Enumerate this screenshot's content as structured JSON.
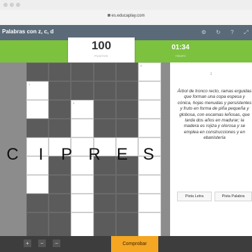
{
  "browser": {
    "url": "es.educaplay.com"
  },
  "game": {
    "title": "Palabras con z, c, d",
    "score": "100",
    "score_label": "PUNTOS",
    "timer": "01:34",
    "timer_label": "TIEMPO"
  },
  "toolbar_icons": [
    "settings-icon",
    "restart-icon",
    "help-icon",
    "fullscreen-icon"
  ],
  "board": {
    "answer_letters": [
      "C",
      "I",
      "P",
      "R",
      "E",
      "S"
    ],
    "cell_numbers": {
      "n1": "1",
      "n2": "2",
      "n4": "4"
    }
  },
  "panel": {
    "clue_number": "1",
    "clue_text": "Árbol de tronco recto, ramas erguidas que forman una copa espesa y cónica, hojas menudas y persistentes y fruto en forma de piña pequeña y globosa, con escamas leñosas, que tarda dos años en madurar; la madera es rojiza y olorosa y se emplea en construcciones y en ebanistería",
    "hint_letter": "Pista Letra",
    "hint_word": "Pista Palabra"
  },
  "footer": {
    "check_button": "Comprobar",
    "buttons": [
      "+",
      "−",
      "−"
    ]
  }
}
